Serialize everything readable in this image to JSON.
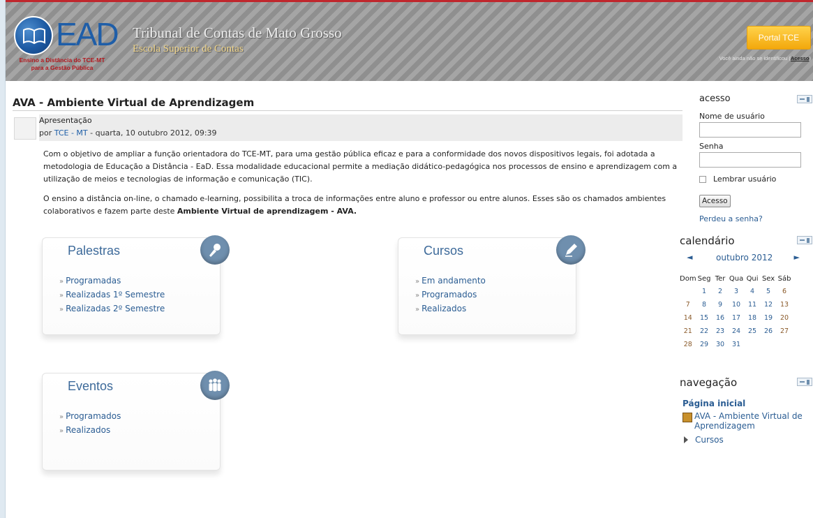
{
  "header": {
    "logo_text": "EAD",
    "logo_sub_1": "Ensino a Distância do TCE-MT",
    "logo_sub_2": "para a Gestão Pública",
    "site_title": "Tribunal de Contas de Mato Grosso",
    "site_subtitle": "Escola Superior de Contas",
    "portal_button": "Portal TCE",
    "login_info_text": "Você ainda não se identificou (",
    "login_link": "Acesso",
    "login_info_end": ")"
  },
  "main": {
    "page_title": "AVA - Ambiente Virtual de Aprendizagem",
    "post": {
      "subject": "Apresentação",
      "by": "por",
      "author": "TCE - MT",
      "date": "- quarta, 10 outubro 2012, 09:39",
      "paragraph1": "Com o objetivo de ampliar a função orientadora do TCE-MT, para uma gestão pública eficaz e para a conformidade dos novos dispositivos legais, foi adotada a metodologia de Educação a Distância - EaD. Essa modalidade educacional permite a mediação didático-pedagógica nos processos de ensino e aprendizagem com a utilização de meios e tecnologias de informação e comunicação (TIC).",
      "paragraph2_start": "O ensino a distância on-line, o chamado e-learning, possibilita a troca de informações entre aluno e professor ou entre alunos. Esses são os chamados ambientes colaborativos e fazem parte deste ",
      "paragraph2_bold": "Ambiente Virtual de aprendizagem - AVA."
    },
    "categories": [
      {
        "title": "Palestras",
        "icon": "microphone-icon",
        "links": [
          "Programadas",
          "Realizadas 1º Semestre",
          "Realizadas 2º Semestre"
        ]
      },
      {
        "title": "Cursos",
        "icon": "pencil-icon",
        "links": [
          "Em andamento",
          "Programados",
          "Realizados"
        ]
      },
      {
        "title": "Eventos",
        "icon": "people-icon",
        "links": [
          "Programados",
          "Realizados"
        ]
      }
    ]
  },
  "sidebar": {
    "login": {
      "title": "acesso",
      "username_label": "Nome de usuário",
      "password_label": "Senha",
      "remember_label": "Lembrar usuário",
      "submit_label": "Acesso",
      "forgot_label": "Perdeu a senha?"
    },
    "calendar": {
      "title": "calendário",
      "prev": "◄",
      "next": "►",
      "month": "outubro 2012",
      "weekdays": [
        "Dom",
        "Seg",
        "Ter",
        "Qua",
        "Qui",
        "Sex",
        "Sáb"
      ],
      "weeks": [
        [
          "",
          "1",
          "2",
          "3",
          "4",
          "5",
          "6"
        ],
        [
          "7",
          "8",
          "9",
          "10",
          "11",
          "12",
          "13"
        ],
        [
          "14",
          "15",
          "16",
          "17",
          "18",
          "19",
          "20"
        ],
        [
          "21",
          "22",
          "23",
          "24",
          "25",
          "26",
          "27"
        ],
        [
          "28",
          "29",
          "30",
          "31",
          "",
          "",
          ""
        ]
      ]
    },
    "navigation": {
      "title": "navegação",
      "home": "Página inicial",
      "ava": "AVA - Ambiente Virtual de Aprendizagem",
      "courses": "Cursos"
    }
  },
  "colors": {
    "accent_blue": "#2b5d93",
    "header_stripe": "#8f8f8f",
    "portal_orange": "#f3a80c",
    "brand_red": "#b3171d"
  }
}
